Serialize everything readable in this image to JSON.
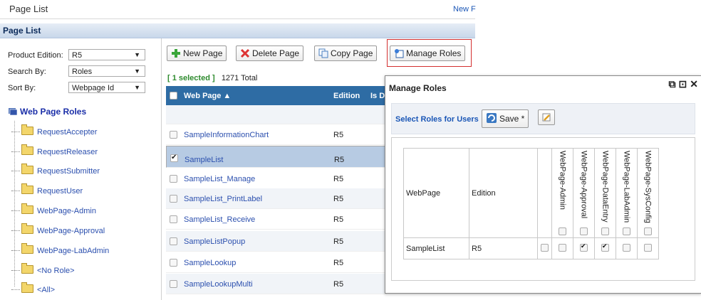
{
  "page": {
    "title": "Page List",
    "top_link": "New F",
    "section_title": "Page List"
  },
  "filters": {
    "product_edition_label": "Product Edition:",
    "product_edition_value": "R5",
    "search_by_label": "Search By:",
    "search_by_value": "Roles",
    "sort_by_label": "Sort By:",
    "sort_by_value": "Webpage Id"
  },
  "tree": {
    "root": "Web Page Roles",
    "items": [
      "RequestAccepter",
      "RequestReleaser",
      "RequestSubmitter",
      "RequestUser",
      "WebPage-Admin",
      "WebPage-Approval",
      "WebPage-LabAdmin",
      "<No Role>",
      "<All>"
    ]
  },
  "toolbar": {
    "new_page": "New Page",
    "delete_page": "Delete Page",
    "copy_page": "Copy Page",
    "manage_roles": "Manage Roles"
  },
  "list": {
    "selected_text": "[ 1 selected ]",
    "total_text": "1271 Total",
    "col_webpage": "Web Page ▲",
    "col_edition": "Edition",
    "col_isd": "Is D",
    "rows": [
      {
        "name": "SampleInformationChart",
        "edition": "R5"
      },
      {
        "name": "SampleList",
        "edition": "R5"
      },
      {
        "name": "SampleList_Manage",
        "edition": "R5"
      },
      {
        "name": "SampleList_PrintLabel",
        "edition": "R5"
      },
      {
        "name": "SampleList_Receive",
        "edition": "R5"
      },
      {
        "name": "SampleListPopup",
        "edition": "R5"
      },
      {
        "name": "SampleLookup",
        "edition": "R5"
      },
      {
        "name": "SampleLookupMulti",
        "edition": "R5"
      }
    ]
  },
  "dialog": {
    "title": "Manage Roles",
    "select_label": "Select Roles for Users",
    "save_label": "Save *",
    "col_webpage": "WebPage",
    "col_edition": "Edition",
    "roles": [
      "WebPage-Admin",
      "WebPage-Approval",
      "WebPage-DataEntry",
      "WebPage-LabAdmin",
      "WebPage-SysConfig"
    ],
    "row": {
      "webpage": "SampleList",
      "edition": "R5",
      "checked": [
        false,
        true,
        true,
        false,
        false
      ]
    }
  }
}
